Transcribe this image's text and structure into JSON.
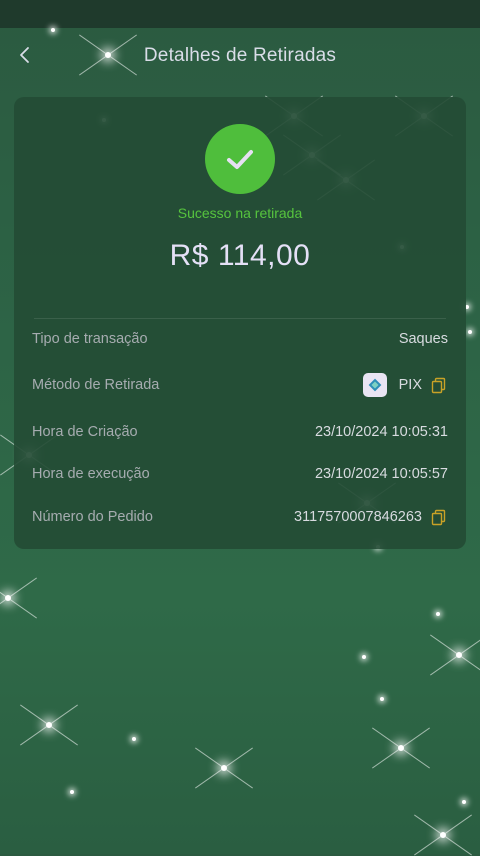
{
  "header": {
    "title": "Detalhes de Retiradas"
  },
  "summary": {
    "status": "Sucesso na retirada",
    "amount": "R$ 114,00"
  },
  "details": [
    {
      "label": "Tipo de transação",
      "value": "Saques"
    },
    {
      "label": "Método de Retirada",
      "value": "PIX"
    },
    {
      "label": "Hora de Criação",
      "value": "23/10/2024 10:05:31"
    },
    {
      "label": "Hora de execução",
      "value": "23/10/2024 10:05:57"
    },
    {
      "label": "Número do Pedido",
      "value": "3117570007846263"
    }
  ],
  "icons": {
    "back": "chevron-left-icon",
    "success": "check-circle-icon",
    "copy": "copy-icon",
    "pix": "pix-logo-icon"
  },
  "colors": {
    "success_green": "#4fbe3c",
    "card_bg": "#244c35",
    "accent_gold": "#c9a227"
  }
}
